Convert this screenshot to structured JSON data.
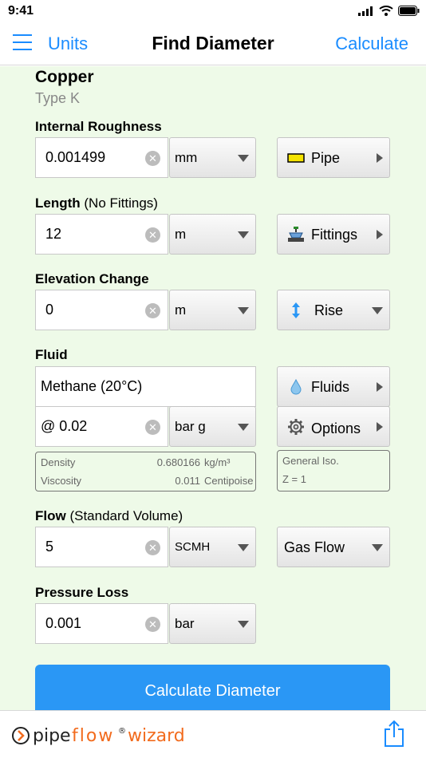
{
  "status": {
    "time": "9:41"
  },
  "nav": {
    "left_label": "Units",
    "title": "Find Diameter",
    "right_label": "Calculate"
  },
  "material": {
    "name": "Copper",
    "type": "Type K"
  },
  "roughness": {
    "label": "Internal Roughness",
    "value": "0.001499",
    "unit": "mm",
    "button": "Pipe"
  },
  "length": {
    "label": "Length",
    "note": "(No Fittings)",
    "value": "12",
    "unit": "m",
    "button": "Fittings"
  },
  "elevation": {
    "label": "Elevation Change",
    "value": "0",
    "unit": "m",
    "direction": "Rise"
  },
  "fluid": {
    "label": "Fluid",
    "name": "Methane (20°C)",
    "pressure": "@ 0.02",
    "pressure_unit": "bar g",
    "fluids_button": "Fluids",
    "options_button": "Options",
    "density_label": "Density",
    "density_value": "0.680166",
    "density_unit": "kg/m³",
    "viscosity_label": "Viscosity",
    "viscosity_value": "0.011",
    "viscosity_unit": "Centipoise",
    "gas_model": "General Iso.",
    "z_factor": "Z = 1"
  },
  "flow": {
    "label": "Flow",
    "note": "(Standard Volume)",
    "value": "5",
    "unit": "SCMH",
    "type": "Gas Flow"
  },
  "pressure_loss": {
    "label": "Pressure Loss",
    "value": "0.001",
    "unit": "bar"
  },
  "calculate_button": "Calculate Diameter",
  "footer": {
    "logo_text": "pipeflow® wizard"
  },
  "colors": {
    "accent": "#1a8cff",
    "button": "#2a97f5",
    "background": "#eefae8",
    "logo_orange": "#f26b1d"
  },
  "icons": {
    "menu": "hamburger-icon",
    "pipe": "pipe-icon",
    "fittings": "valve-icon",
    "rise": "vertical-arrows-icon",
    "fluids": "droplet-icon",
    "options": "gear-icon",
    "clear": "clear-icon",
    "share": "share-icon"
  }
}
